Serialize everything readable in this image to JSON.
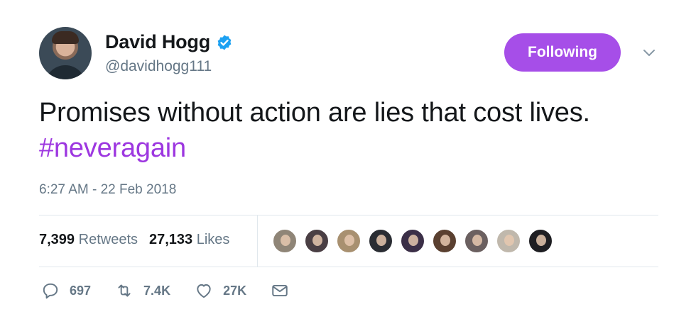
{
  "author": {
    "display_name": "David Hogg",
    "handle": "@davidhogg111",
    "verified": true
  },
  "follow_button": {
    "label": "Following",
    "color": "#a64ee8"
  },
  "tweet": {
    "text": "Promises without action are lies that cost lives.",
    "hashtag": "#neveragain",
    "timestamp": "6:27 AM - 22 Feb 2018"
  },
  "stats": {
    "retweets_count": "7,399",
    "retweets_label": "Retweets",
    "likes_count": "27,133",
    "likes_label": "Likes"
  },
  "liker_avatars": [
    "#8f8577",
    "#4a3f44",
    "#a89070",
    "#2a2d33",
    "#3b2f47",
    "#5a4030",
    "#6b6060",
    "#c0b8ac",
    "#1e1e22"
  ],
  "actions": {
    "reply_count": "697",
    "retweet_count": "7.4K",
    "like_count": "27K"
  },
  "colors": {
    "accent": "#a64ee8",
    "hashtag": "#9d37e0",
    "verified": "#1da1f2",
    "secondary_text": "#657786"
  }
}
